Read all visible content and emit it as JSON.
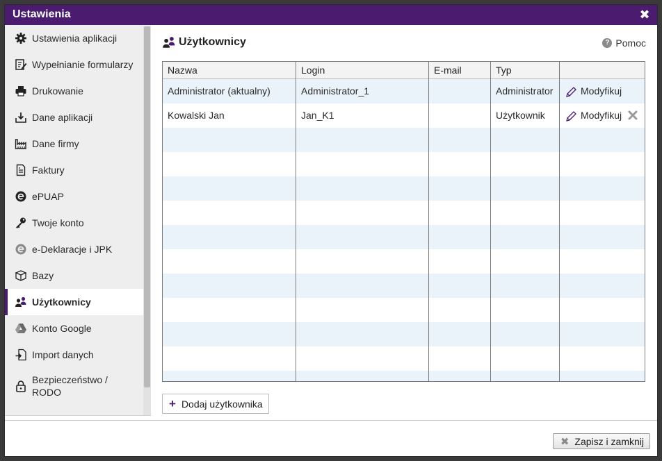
{
  "window": {
    "title": "Ustawienia",
    "close_glyph": "✖"
  },
  "sidebar": {
    "items": [
      {
        "label": "Ustawienia aplikacji",
        "icon": "gear-icon"
      },
      {
        "label": "Wypełnianie formularzy",
        "icon": "form-edit-icon"
      },
      {
        "label": "Drukowanie",
        "icon": "printer-icon"
      },
      {
        "label": "Dane aplikacji",
        "icon": "download-tray-icon"
      },
      {
        "label": "Dane firmy",
        "icon": "factory-icon"
      },
      {
        "label": "Faktury",
        "icon": "invoice-icon"
      },
      {
        "label": "ePUAP",
        "icon": "epuap-icon"
      },
      {
        "label": "Twoje konto",
        "icon": "key-icon"
      },
      {
        "label": "e-Deklaracje i JPK",
        "icon": "edeklaracje-icon"
      },
      {
        "label": "Bazy",
        "icon": "box-icon"
      },
      {
        "label": "Użytkownicy",
        "icon": "users-icon",
        "active": true
      },
      {
        "label": "Konto Google",
        "icon": "google-drive-icon"
      },
      {
        "label": "Import danych",
        "icon": "import-icon"
      },
      {
        "label": "Bezpieczeństwo /\nRODO",
        "icon": "lock-icon"
      }
    ]
  },
  "main": {
    "title": "Użytkownicy",
    "help_label": "Pomoc",
    "table": {
      "columns": [
        "Nazwa",
        "Login",
        "E-mail",
        "Typ",
        ""
      ],
      "rows": [
        {
          "name": "Administrator (aktualny)",
          "login": "Administrator_1",
          "email": "",
          "type": "Administrator",
          "action": "Modyfikuj",
          "deletable": false
        },
        {
          "name": "Kowalski Jan",
          "login": "Jan_K1",
          "email": "",
          "type": "Użytkownik",
          "action": "Modyfikuj",
          "deletable": true
        }
      ]
    },
    "add_user_label": "Dodaj użytkownika"
  },
  "footer": {
    "save_close_label": "Zapisz i zamknij"
  },
  "colors": {
    "accent": "#4a1b6e",
    "row_alt": "#eaf2fa",
    "sidebar_bg": "#eeeeee"
  }
}
